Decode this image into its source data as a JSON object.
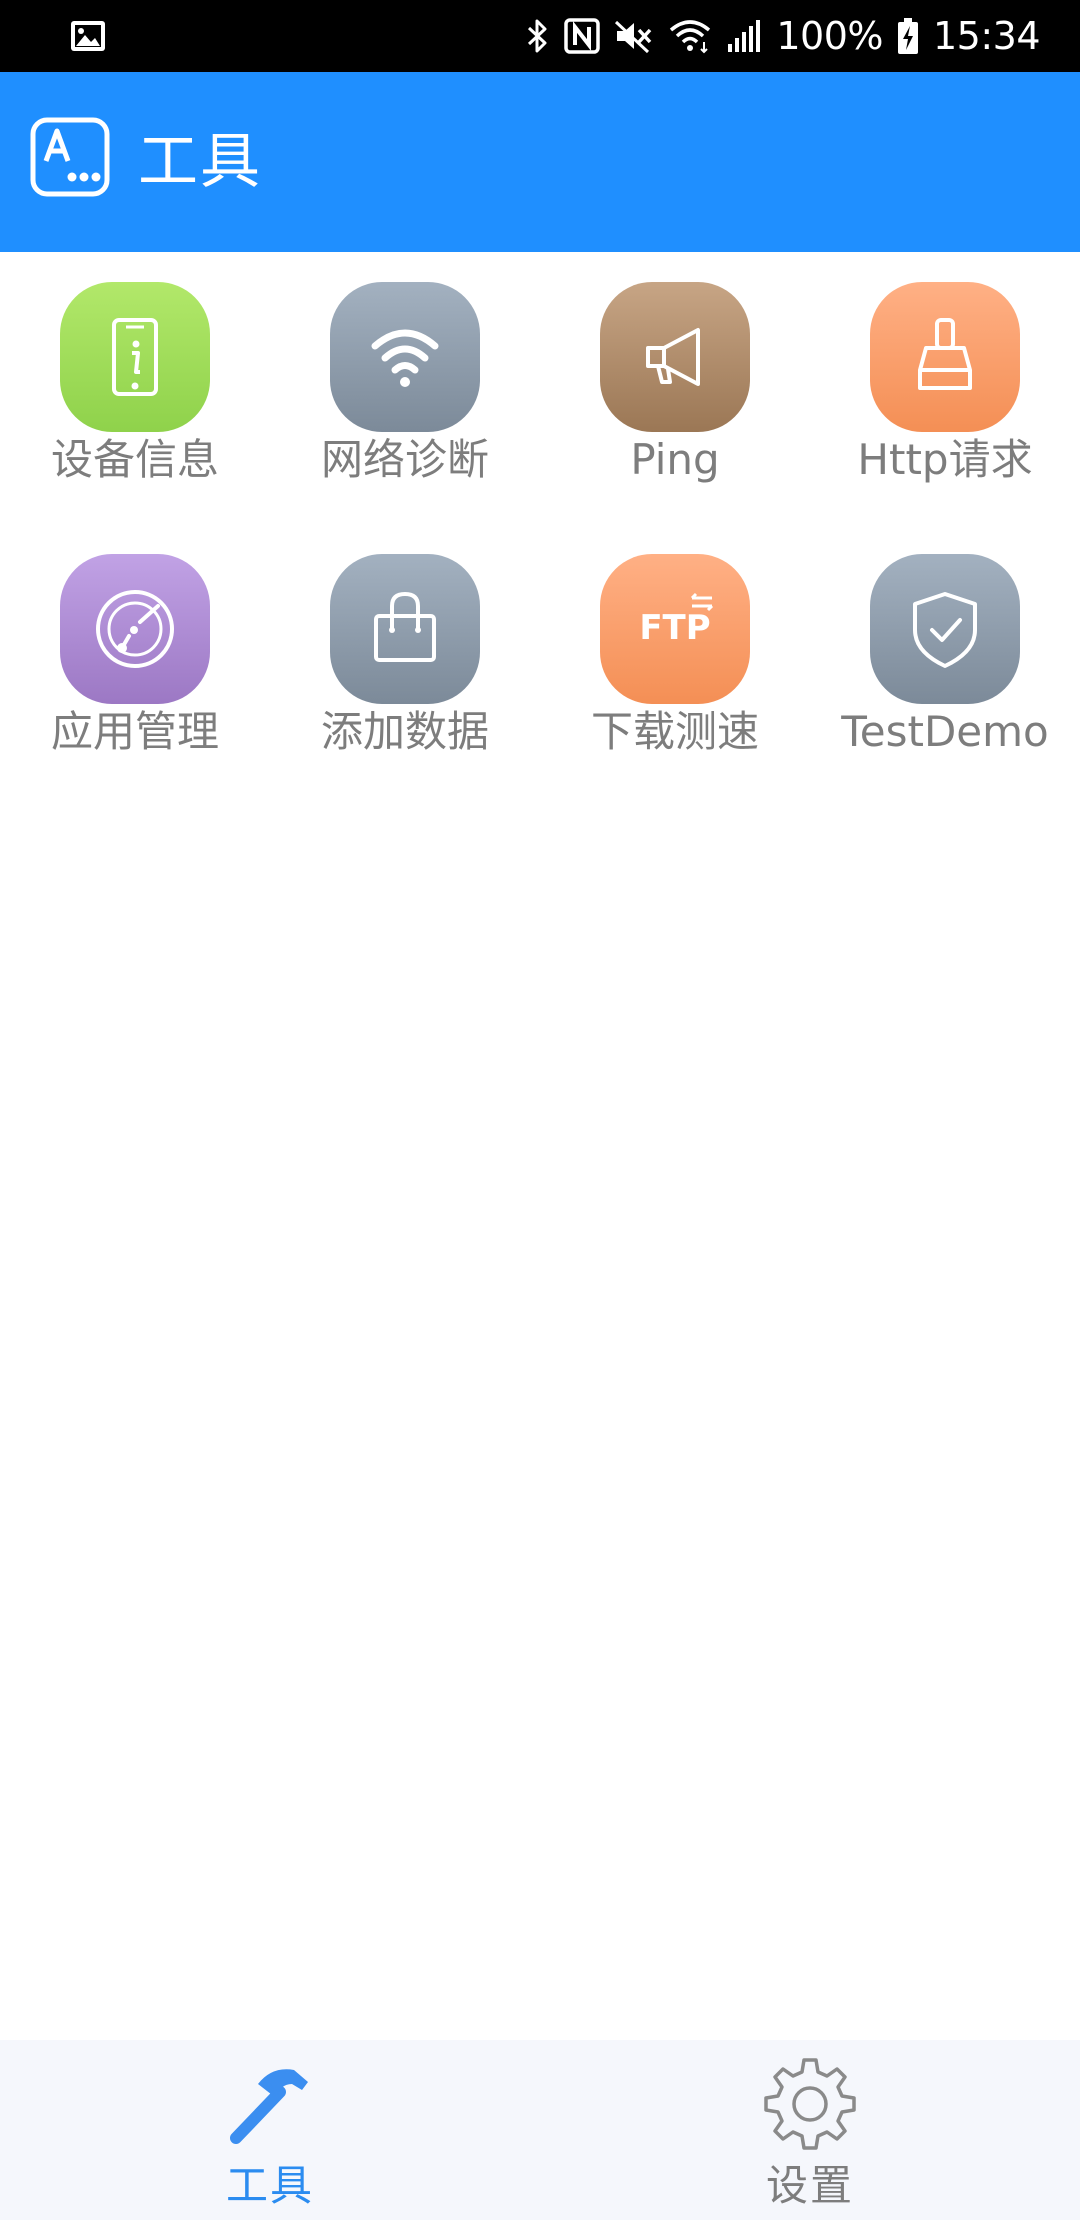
{
  "status_bar": {
    "battery": "100%",
    "time": "15:34",
    "icons": [
      "image-icon",
      "bluetooth-icon",
      "nfc-icon",
      "mute-icon",
      "wifi-icon",
      "signal-icon",
      "battery-charging-icon"
    ]
  },
  "app_bar": {
    "title": "工具",
    "logo_icon": "app-logo-icon",
    "color": "#1f8fff"
  },
  "tools": [
    {
      "label": "设备信息",
      "icon": "phone-info-icon"
    },
    {
      "label": "网络诊断",
      "icon": "wifi-icon"
    },
    {
      "label": "Ping",
      "icon": "megaphone-icon"
    },
    {
      "label": "Http请求",
      "icon": "broom-icon"
    },
    {
      "label": "应用管理",
      "icon": "radar-icon"
    },
    {
      "label": "添加数据",
      "icon": "shopping-bag-icon"
    },
    {
      "label": "下载测速",
      "icon": "ftp-icon",
      "icon_text": "FTP"
    },
    {
      "label": "TestDemo",
      "icon": "shield-check-icon"
    }
  ],
  "bottom_nav": {
    "items": [
      {
        "label": "工具",
        "icon": "hammer-icon",
        "active": true
      },
      {
        "label": "设置",
        "icon": "gear-icon",
        "active": false
      }
    ],
    "active_color": "#2b8cf0",
    "inactive_color": "#7d7d7d"
  }
}
